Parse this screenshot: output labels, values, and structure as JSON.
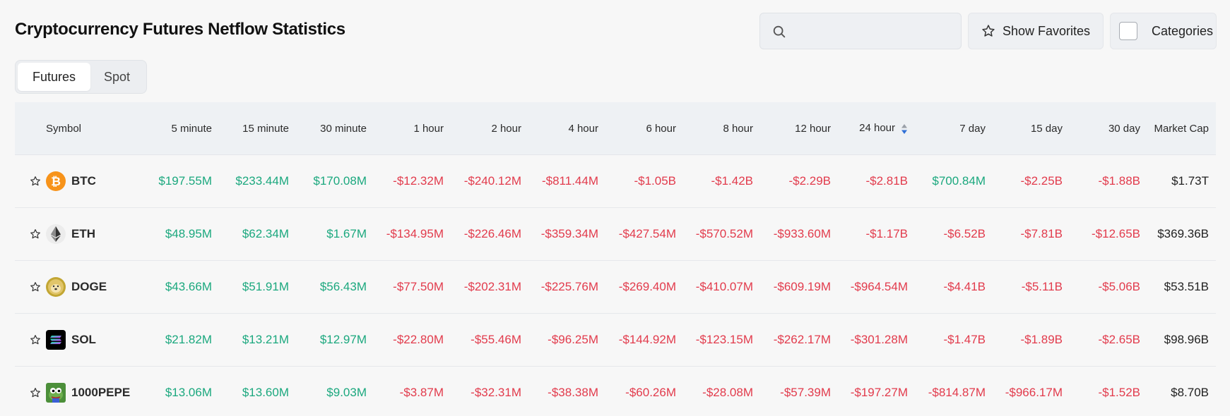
{
  "page": {
    "title": "Cryptocurrency Futures Netflow Statistics"
  },
  "search": {
    "placeholder": "",
    "value": ""
  },
  "toolbar": {
    "favorites_label": "Show Favorites",
    "categories_label": "Categories"
  },
  "tabs": [
    {
      "label": "Futures",
      "active": true
    },
    {
      "label": "Spot",
      "active": false
    }
  ],
  "table": {
    "columns": [
      "Symbol",
      "5 minute",
      "15 minute",
      "30 minute",
      "1 hour",
      "2 hour",
      "4 hour",
      "6 hour",
      "8 hour",
      "12 hour",
      "24 hour",
      "7 day",
      "15 day",
      "30 day",
      "Market Cap"
    ],
    "sorted_column": "24 hour",
    "rows": [
      {
        "symbol": "BTC",
        "icon": "bitcoin-icon",
        "values": [
          "$197.55M",
          "$233.44M",
          "$170.08M",
          "-$12.32M",
          "-$240.12M",
          "-$811.44M",
          "-$1.05B",
          "-$1.42B",
          "-$2.29B",
          "-$2.81B",
          "$700.84M",
          "-$2.25B",
          "-$1.88B"
        ],
        "market_cap": "$1.73T"
      },
      {
        "symbol": "ETH",
        "icon": "ethereum-icon",
        "values": [
          "$48.95M",
          "$62.34M",
          "$1.67M",
          "-$134.95M",
          "-$226.46M",
          "-$359.34M",
          "-$427.54M",
          "-$570.52M",
          "-$933.60M",
          "-$1.17B",
          "-$6.52B",
          "-$7.81B",
          "-$12.65B"
        ],
        "market_cap": "$369.36B"
      },
      {
        "symbol": "DOGE",
        "icon": "dogecoin-icon",
        "values": [
          "$43.66M",
          "$51.91M",
          "$56.43M",
          "-$77.50M",
          "-$202.31M",
          "-$225.76M",
          "-$269.40M",
          "-$410.07M",
          "-$609.19M",
          "-$964.54M",
          "-$4.41B",
          "-$5.11B",
          "-$5.06B"
        ],
        "market_cap": "$53.51B"
      },
      {
        "symbol": "SOL",
        "icon": "solana-icon",
        "values": [
          "$21.82M",
          "$13.21M",
          "$12.97M",
          "-$22.80M",
          "-$55.46M",
          "-$96.25M",
          "-$144.92M",
          "-$123.15M",
          "-$262.17M",
          "-$301.28M",
          "-$1.47B",
          "-$1.89B",
          "-$2.65B"
        ],
        "market_cap": "$98.96B"
      },
      {
        "symbol": "1000PEPE",
        "icon": "pepe-icon",
        "values": [
          "$13.06M",
          "$13.60M",
          "$9.03M",
          "-$3.87M",
          "-$32.31M",
          "-$38.38M",
          "-$60.26M",
          "-$28.08M",
          "-$57.39M",
          "-$197.27M",
          "-$814.87M",
          "-$966.17M",
          "-$1.52B"
        ],
        "market_cap": "$8.70B"
      }
    ]
  },
  "colors": {
    "positive": "#1ba87e",
    "negative": "#e23b4c",
    "sort_active": "#2f6fd6"
  }
}
